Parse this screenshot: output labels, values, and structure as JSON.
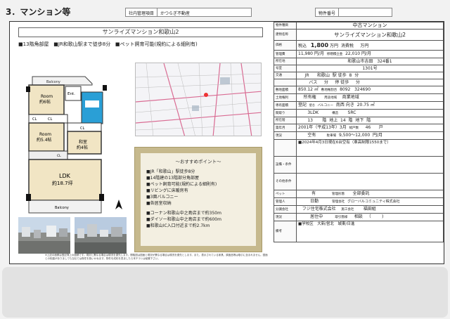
{
  "page": {
    "section_title": "3．マンション等"
  },
  "header": {
    "company_label": "社内管理項目",
    "company": "かつらぎ不動産",
    "number_label": "物件番号",
    "number": ""
  },
  "left": {
    "title": "サンライズマンション和歌山2",
    "features": [
      "■13階角部屋",
      "■JR和歌山駅まで徒歩8分",
      "■ペット飼育可能(規約による細則有)"
    ],
    "floorplan": {
      "balcony_top": "Balcony",
      "balcony_bottom": "Balcony",
      "ent": "Ent.",
      "room1": "Room",
      "room1_size": "約6帖",
      "room2": "Room",
      "room2_size": "約5.4帖",
      "washitsu": "和室",
      "washitsu_size": "約4帖",
      "ldk": "LDK",
      "ldk_size": "約18.7坪",
      "cl1": "CL",
      "cl2": "CL",
      "cl3": "CL",
      "cl4": "CL"
    },
    "recommend": {
      "heading": "～おすすめポイント～",
      "items": [
        "■JR「和歌山」駅徒歩8分",
        "■14階建の13階部分角部屋",
        "■ペット飼育可能(規約による細則有)",
        "■リビングに床暖房有",
        "■3面バルコニー",
        "■各居室収納"
      ],
      "nearby": [
        "■コーナン和歌山中之島店まで約350m",
        "■ダイソー和歌山中之島店まで約600m",
        "■和歌山IC入口付近まで約2.7km"
      ]
    },
    "notes": "※上記の面積は登記簿上の面積です。現況と異なる場合は現況を優先します。間取図は図面と現況が異なる場合は現況を優先とします。また、表示されている家具、調度品等は取引に含まれません。図面との相違がありましても当社では責任を負いかねます。物件を成約を見ましたら本チラシは破棄下さい。"
  },
  "right": {
    "rows": [
      {
        "label": "物件種目",
        "cells": [
          "中古マンション"
        ]
      },
      {
        "label": "建物名称",
        "cells": [
          "サンライズマンション和歌山2"
        ]
      },
      {
        "label": "価格",
        "cells": [
          "税込",
          "1,800",
          "万円",
          "消費税",
          "万円"
        ]
      },
      {
        "label": "管理費",
        "cells": [
          "11,980",
          "円/月",
          "修繕積立金",
          "22,010",
          "円/月"
        ]
      },
      {
        "label": "所在地",
        "cells": [
          "和歌山市吉田　324番1"
        ]
      },
      {
        "label": "号室",
        "cells": [
          "1301号"
        ]
      },
      {
        "label": "交通",
        "cells": [
          "JR",
          "和歌山",
          "駅 徒歩",
          "8",
          "分"
        ]
      },
      {
        "label": "",
        "cells": [
          "バス",
          "分",
          "停 徒歩",
          "分"
        ]
      },
      {
        "label": "敷地面積",
        "cells": [
          "850.12",
          "㎡",
          "敷地権割合",
          "8092",
          "324690"
        ]
      },
      {
        "label": "土地権利",
        "cells": [
          "所有権",
          "用途地域",
          "商業地域"
        ]
      },
      {
        "label": "専有面積",
        "cells": [
          "登記",
          "壁芯",
          "バルコニー",
          "南西",
          "向き",
          "20.75",
          "㎡"
        ]
      },
      {
        "label": "間取り",
        "cells": [
          "3LDK",
          "構造",
          "SRC"
        ]
      },
      {
        "label": "所在階",
        "cells": [
          "13",
          "階",
          "地上",
          "14",
          "階",
          "地下",
          "階"
        ]
      },
      {
        "label": "築年月",
        "cells": [
          "2001年（平成13年）3月",
          "総戸数",
          "46",
          "戸"
        ]
      },
      {
        "label": "現況",
        "cells": [
          "空有",
          "駐車場",
          "9,500～12,000",
          "円/月"
        ]
      },
      {
        "label": "",
        "cells": [
          "■2024年4月3日現在6台空有（車高制限1550まで）"
        ]
      },
      {
        "label": "設備・条件",
        "cells": [
          ""
        ]
      },
      {
        "label": "その他条件",
        "cells": [
          ""
        ]
      },
      {
        "label": "ペット",
        "cells": [
          "有",
          "管理形態",
          "全部委託"
        ]
      },
      {
        "label": "管理人",
        "cells": [
          "日勤",
          "管理会社",
          "グローバルコミュニティ株式会社"
        ]
      },
      {
        "label": "分譲会社",
        "cells": [
          "フジ住宅株式会社",
          "施工会社",
          "福田組"
        ]
      },
      {
        "label": "現況",
        "cells": [
          "居住中",
          "取引態様",
          "相談",
          "（",
          ")"
        ]
      },
      {
        "label": "備考",
        "cells": [
          "■学校区　大新/営北　城東/日進"
        ]
      }
    ]
  },
  "colors": {
    "recommend_frame": "#c6b98d",
    "recommend_bg": "#f3efe1",
    "floorplan_cl": "#2a9fd6"
  }
}
